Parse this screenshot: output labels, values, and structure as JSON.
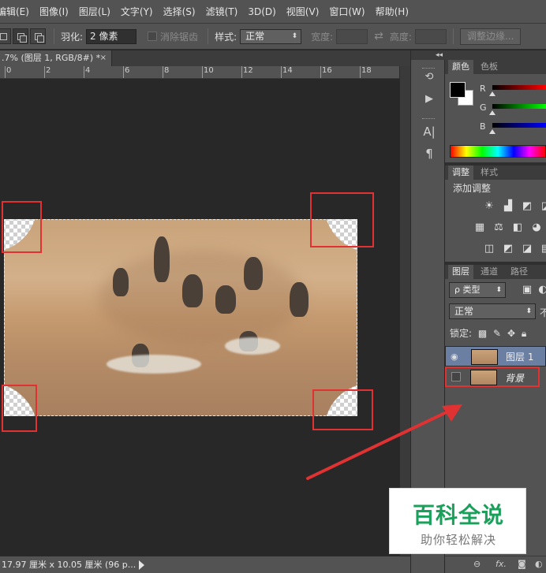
{
  "menu": [
    "编辑(E)",
    "图像(I)",
    "图层(L)",
    "文字(Y)",
    "选择(S)",
    "滤镜(T)",
    "3D(D)",
    "视图(V)",
    "窗口(W)",
    "帮助(H)"
  ],
  "options": {
    "feather_label": "羽化:",
    "feather_value": "2 像素",
    "antialias_label": "消除锯齿",
    "style_label": "样式:",
    "style_value": "正常",
    "width_label": "宽度:",
    "height_label": "高度:",
    "refine_edge_button": "调整边缘..."
  },
  "document": {
    "tab_title": ".7% (图层 1, RGB/8#) *",
    "close_symbol": "×",
    "ruler_ticks": [
      "0",
      "2",
      "4",
      "6",
      "8",
      "10",
      "12",
      "14",
      "16",
      "18"
    ]
  },
  "status": {
    "doc_size": "17.97 厘米 x 10.05 厘米 (96 p..."
  },
  "dock": {
    "collapse_symbol": "◂◂",
    "text_tool_glyph": "A|",
    "paragraph_glyph": "¶"
  },
  "color_panel": {
    "tabs": [
      "颜色",
      "色板"
    ],
    "channels": [
      "R",
      "G",
      "B"
    ],
    "foreground": "#000000",
    "background": "#ffffff"
  },
  "adjust_panel": {
    "tabs": [
      "调整",
      "样式"
    ],
    "title": "添加调整"
  },
  "layers_panel": {
    "tabs": [
      "图层",
      "通道",
      "路径"
    ],
    "filter_kind": "ρ 类型",
    "blend_mode": "正常",
    "opacity_stub": "不",
    "lock_label": "锁定:",
    "layers": [
      {
        "name": "图层 1",
        "visible": true,
        "selected": true
      },
      {
        "name": "背景",
        "visible": false,
        "selected": false
      }
    ],
    "footer_fx": "fx."
  },
  "colors": {
    "highlight_red": "#e03232",
    "layer_selected": "#6b7fa3",
    "watermark_green": "#19a05a"
  },
  "watermark": {
    "title": "百科全说",
    "subtitle": "助你轻松解决"
  }
}
